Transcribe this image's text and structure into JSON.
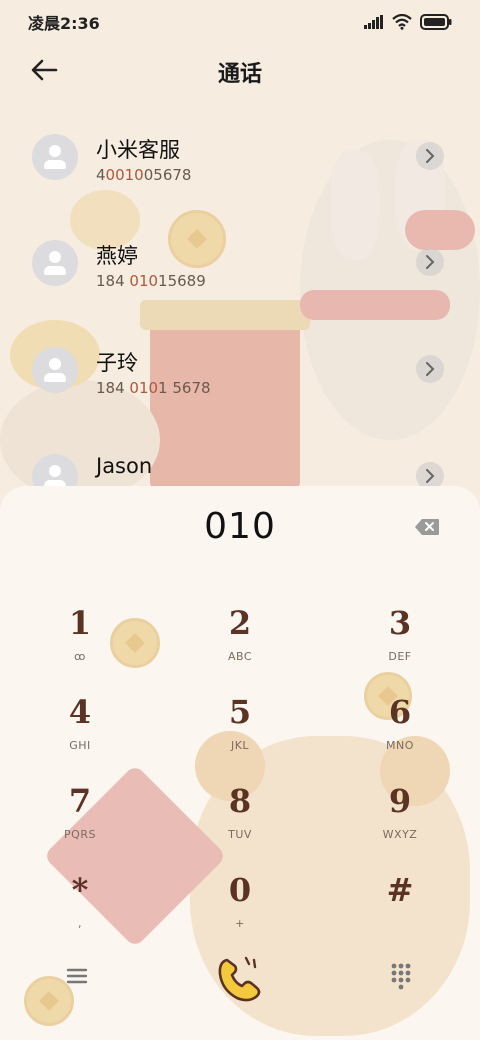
{
  "status": {
    "time": "凌晨2:36"
  },
  "header": {
    "title": "通话"
  },
  "contacts": [
    {
      "name": "小米客服",
      "num_pre": "4",
      "num_hl": "0010",
      "num_post": "05678"
    },
    {
      "name": "燕婷",
      "num_pre": "184 ",
      "num_hl": "010",
      "num_post": "15689"
    },
    {
      "name": "子玲",
      "num_pre": "184 ",
      "num_hl": "010",
      "num_post": "1 5678"
    },
    {
      "name": "Jason",
      "num_pre": "",
      "num_hl": "",
      "num_post": ""
    }
  ],
  "dialer": {
    "entry": "010"
  },
  "keys": [
    {
      "digit": "1",
      "sub": "ꝏ"
    },
    {
      "digit": "2",
      "sub": "ABC"
    },
    {
      "digit": "3",
      "sub": "DEF"
    },
    {
      "digit": "4",
      "sub": "GHI"
    },
    {
      "digit": "5",
      "sub": "JKL"
    },
    {
      "digit": "6",
      "sub": "MNO"
    },
    {
      "digit": "7",
      "sub": "PQRS"
    },
    {
      "digit": "8",
      "sub": "TUV"
    },
    {
      "digit": "9",
      "sub": "WXYZ"
    },
    {
      "digit": "*",
      "sub": ","
    },
    {
      "digit": "0",
      "sub": "+"
    },
    {
      "digit": "#",
      "sub": ""
    }
  ],
  "colors": {
    "accent": "#5a3324",
    "panel": "#fbf6ef",
    "call": "#f3c93d"
  },
  "icons": [
    "back-arrow-icon",
    "signal-icon",
    "wifi-icon",
    "battery-icon",
    "person-icon",
    "chevron-right-icon",
    "backspace-icon",
    "voicemail-icon",
    "menu-icon",
    "phone-icon",
    "dialpad-icon"
  ]
}
